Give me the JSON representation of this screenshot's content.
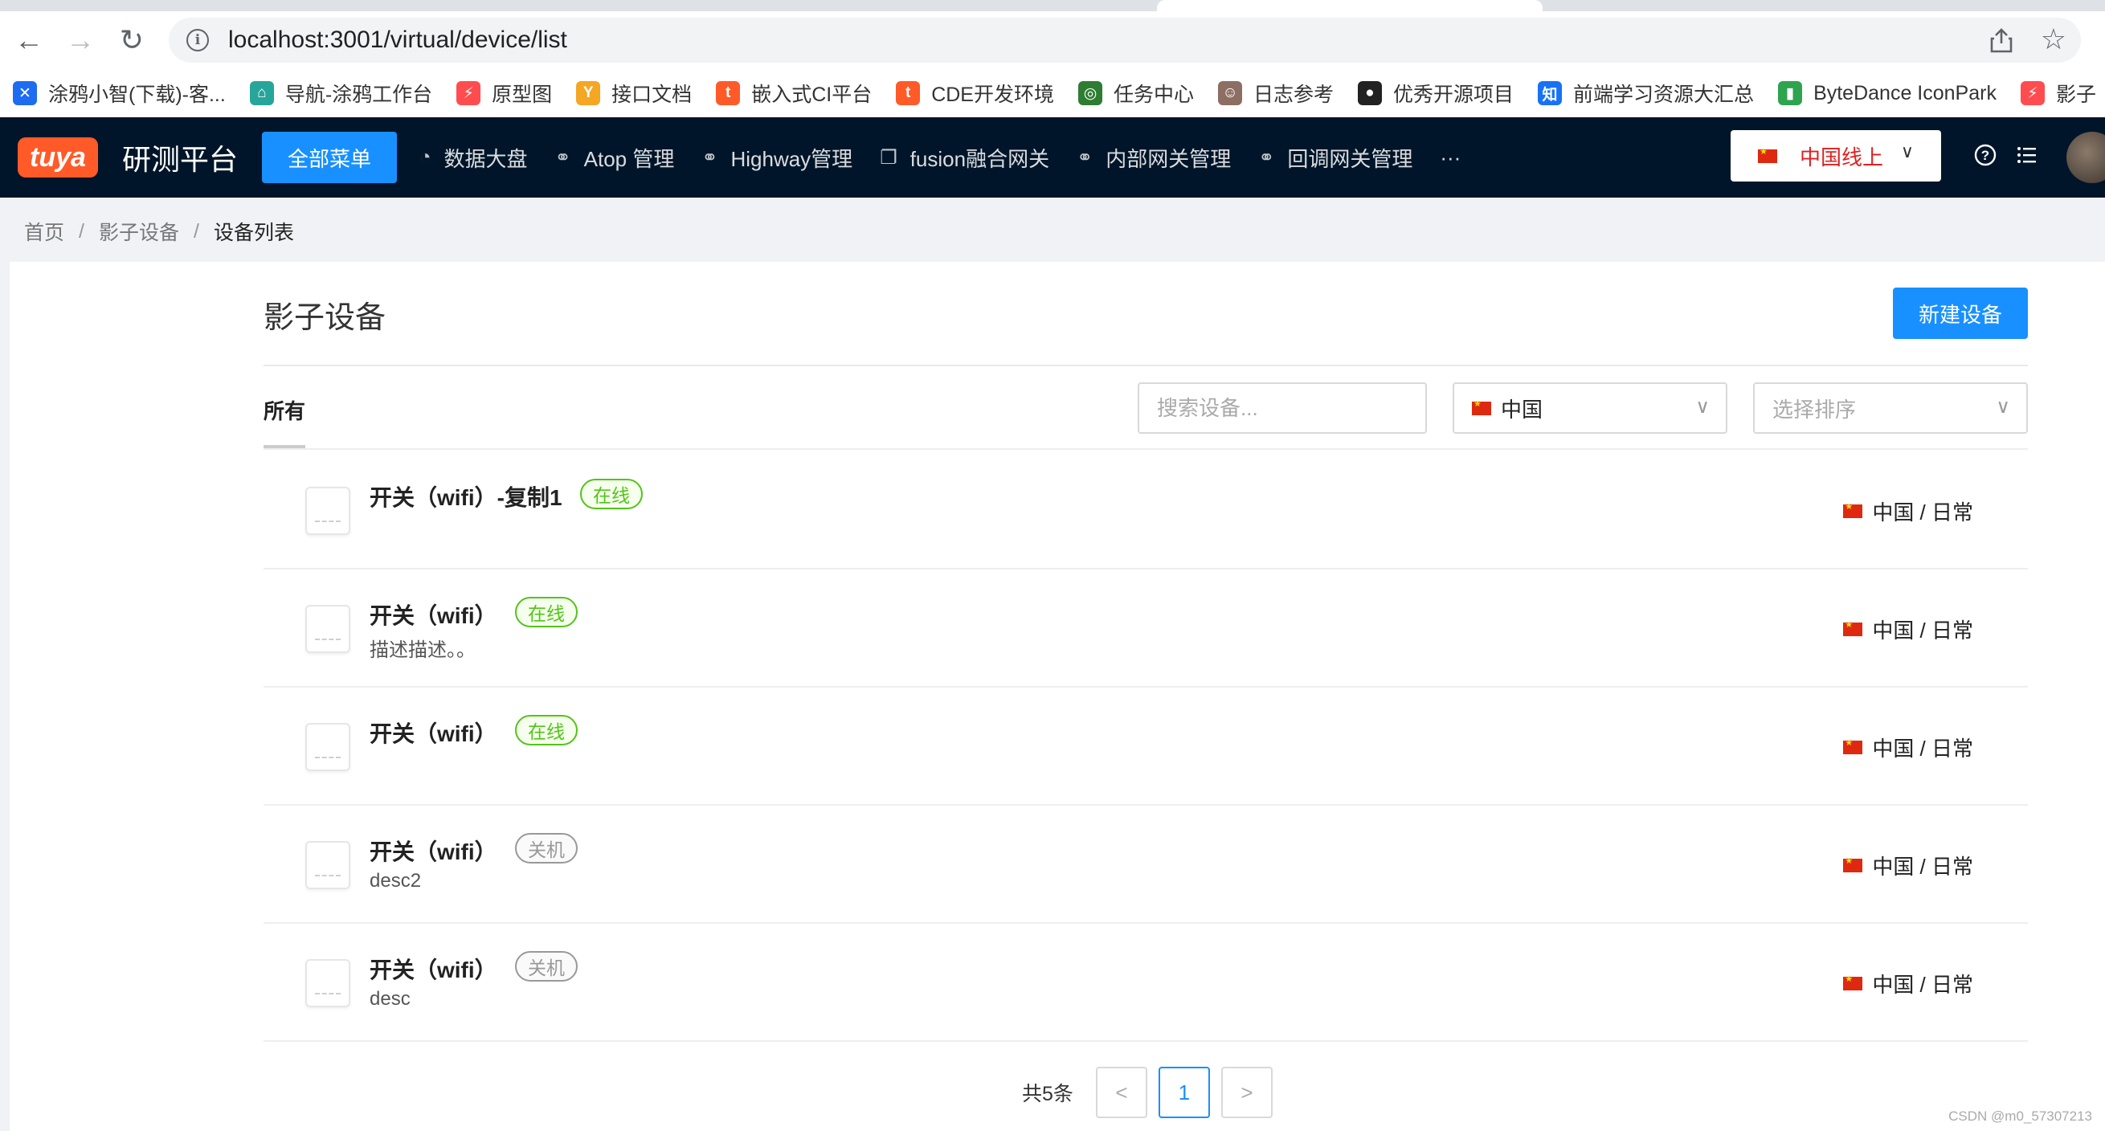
{
  "browser": {
    "url": "localhost:3001/virtual/device/list",
    "bookmarks": [
      {
        "label": "涂鸦小智(下载)-客...",
        "icon": "tuya-butterfly-icon",
        "color": "#1d6cf2"
      },
      {
        "label": "导航-涂鸦工作台",
        "icon": "home-icon",
        "color": "#26a69a"
      },
      {
        "label": "原型图",
        "icon": "axure-icon",
        "color": "#ff4d4f"
      },
      {
        "label": "接口文档",
        "icon": "yapi-icon",
        "color": "#f5a623"
      },
      {
        "label": "嵌入式CI平台",
        "icon": "tuya-t-icon",
        "color": "#ff5a28"
      },
      {
        "label": "CDE开发环境",
        "icon": "tuya-t-icon",
        "color": "#ff5a28"
      },
      {
        "label": "任务中心",
        "icon": "task-icon",
        "color": "#2e7d32"
      },
      {
        "label": "日志参考",
        "icon": "log-avatar-icon",
        "color": "#8d6e63"
      },
      {
        "label": "优秀开源项目",
        "icon": "github-icon",
        "color": "#222222"
      },
      {
        "label": "前端学习资源大汇总",
        "icon": "zhihu-icon",
        "color": "#1772f6"
      },
      {
        "label": "ByteDance IconPark",
        "icon": "iconpark-icon",
        "color": "#2ea44f"
      },
      {
        "label": "影子",
        "icon": "axure-icon",
        "color": "#ff4d4f"
      }
    ]
  },
  "app": {
    "logo_text": "tuya",
    "title": "研测平台",
    "all_menu": "全部菜单",
    "nav": [
      {
        "label": "数据大盘",
        "icon": "pie-chart-icon"
      },
      {
        "label": "Atop 管理",
        "icon": "link-icon"
      },
      {
        "label": "Highway管理",
        "icon": "link-icon"
      },
      {
        "label": "fusion融合网关",
        "icon": "copy-icon"
      },
      {
        "label": "内部网关管理",
        "icon": "link-icon"
      },
      {
        "label": "回调网关管理",
        "icon": "link-icon"
      }
    ],
    "more": "···",
    "region": "中国线上"
  },
  "breadcrumb": {
    "home": "首页",
    "section": "影子设备",
    "current": "设备列表"
  },
  "page": {
    "title": "影子设备",
    "new_button": "新建设备",
    "tab_all": "所有",
    "search_placeholder": "搜索设备...",
    "region_filter": "中国",
    "sort_placeholder": "选择排序"
  },
  "devices": [
    {
      "name": "开关（wifi）-复制1",
      "status": "在线",
      "online": true,
      "desc": "",
      "region": "中国 / 日常"
    },
    {
      "name": "开关（wifi）",
      "status": "在线",
      "online": true,
      "desc": "描述描述。。",
      "region": "中国 / 日常"
    },
    {
      "name": "开关（wifi）",
      "status": "在线",
      "online": true,
      "desc": "",
      "region": "中国 / 日常"
    },
    {
      "name": "开关（wifi）",
      "status": "关机",
      "online": false,
      "desc": "desc2",
      "region": "中国 / 日常"
    },
    {
      "name": "开关（wifi）",
      "status": "关机",
      "online": false,
      "desc": "desc",
      "region": "中国 / 日常"
    }
  ],
  "pagination": {
    "total": "共5条",
    "prev": "<",
    "current": "1",
    "next": ">"
  },
  "watermark": "CSDN @m0_57307213"
}
